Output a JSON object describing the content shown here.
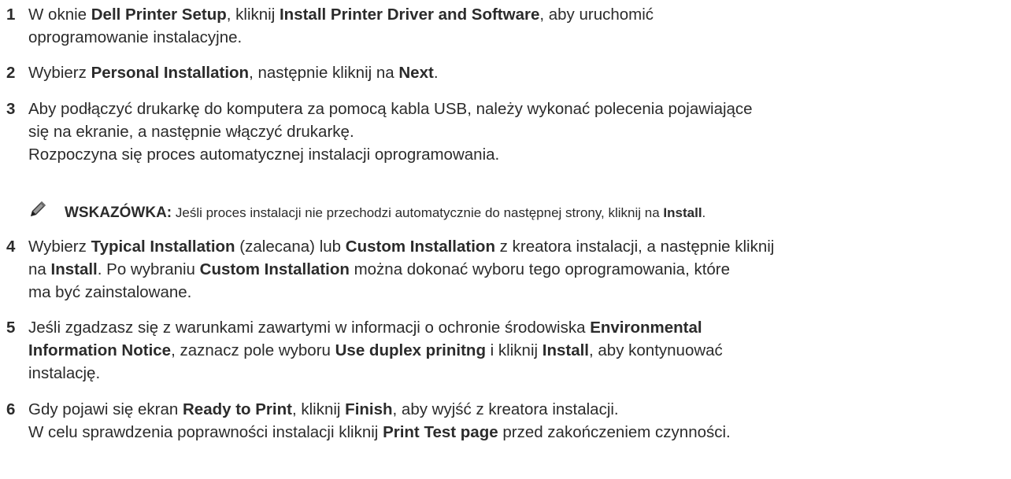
{
  "steps": [
    {
      "num": "1",
      "lines": [
        [
          "W oknie ",
          "Dell Printer Setup",
          ", kliknij ",
          "Install Printer Driver and Software",
          ", aby uruchomić"
        ],
        [
          "oprogramowanie instalacyjne."
        ]
      ]
    },
    {
      "num": "2",
      "lines": [
        [
          "Wybierz ",
          "Personal Installation",
          ", następnie kliknij na ",
          "Next",
          "."
        ]
      ]
    },
    {
      "num": "3",
      "lines": [
        [
          "Aby podłączyć drukarkę do komputera za pomocą kabla USB, należy wykonać polecenia pojawiające"
        ],
        [
          "się na ekranie, a następnie włączyć drukarkę."
        ],
        [
          "Rozpoczyna się proces automatycznej instalacji oprogramowania."
        ]
      ]
    },
    {
      "num": "4",
      "lines": [
        [
          "Wybierz ",
          "Typical Installation",
          " (zalecana) lub ",
          "Custom Installation",
          " z kreatora instalacji, a następnie kliknij"
        ],
        [
          "na ",
          "Install",
          ". Po wybraniu ",
          "Custom Installation",
          " można dokonać wyboru tego oprogramowania, które"
        ],
        [
          "ma być zainstalowane."
        ]
      ]
    },
    {
      "num": "5",
      "lines": [
        [
          "Jeśli zgadzasz się z warunkami zawartymi w informacji o ochronie środowiska ",
          "Environmental"
        ],
        [
          "Information Notice",
          ", zaznacz pole wyboru ",
          "Use duplex prinitng",
          " i kliknij ",
          "Install",
          ", aby kontynuować"
        ],
        [
          "instalację."
        ]
      ]
    },
    {
      "num": "6",
      "lines": [
        [
          "Gdy pojawi się ekran ",
          "Ready to Print",
          ", kliknij ",
          "Finish",
          ", aby wyjść z kreatora instalacji."
        ],
        [
          "W celu sprawdzenia poprawności instalacji kliknij ",
          "Print Test page",
          " przed zakończeniem czynności."
        ]
      ]
    }
  ],
  "tip": {
    "icon": "pencil-note-icon",
    "label": "WSKAZÓWKA:",
    "text_before": " Jeśli proces instalacji nie przechodzi automatycznie do następnej strony, kliknij na ",
    "keyword": "Install",
    "text_after": "."
  }
}
